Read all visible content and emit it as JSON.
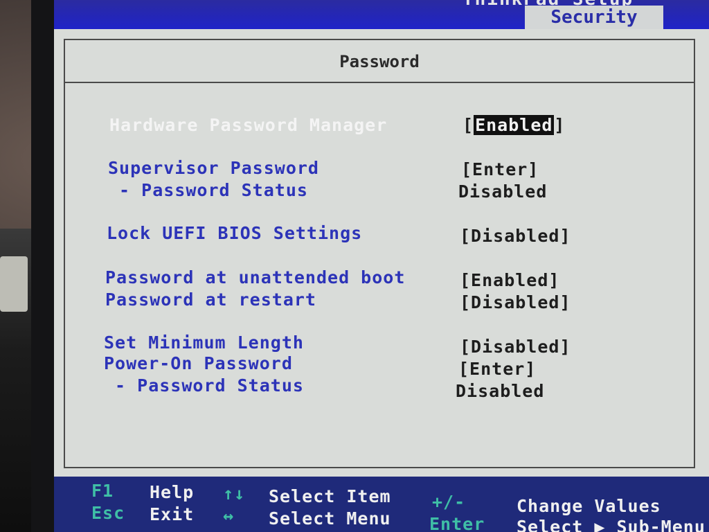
{
  "bios": {
    "top_title": "ThinkPad Setup",
    "active_tab": "Security"
  },
  "panel": {
    "title": "Password"
  },
  "items": [
    {
      "label": "Hardware Password Manager",
      "value": "Enabled",
      "selected": true
    },
    {
      "label": "Supervisor Password",
      "value": "[Enter]"
    },
    {
      "label": " - Password Status",
      "value": "Disabled"
    },
    {
      "label": "Lock UEFI BIOS Settings",
      "value": "[Disabled]"
    },
    {
      "label": "Password at unattended boot",
      "value": "[Enabled]"
    },
    {
      "label": "Password at restart",
      "value": "[Disabled]"
    },
    {
      "label": "Set Minimum Length",
      "value": "[Disabled]"
    },
    {
      "label": "Power-On Password",
      "value": "[Enter]"
    },
    {
      "label": " - Password Status",
      "value": "Disabled"
    }
  ],
  "footer": {
    "f1_key": "F1",
    "f1_desc": "Help",
    "esc_key": "Esc",
    "esc_desc": "Exit",
    "updown_key": "↑↓",
    "updown_desc": "Select Item",
    "leftright_key": "↔",
    "leftright_desc": "Select Menu",
    "plusminus_key": "+/-",
    "plusminus_desc": "Change Values",
    "enter_key": "Enter",
    "enter_desc": "Select ▶ Sub-Menu"
  }
}
